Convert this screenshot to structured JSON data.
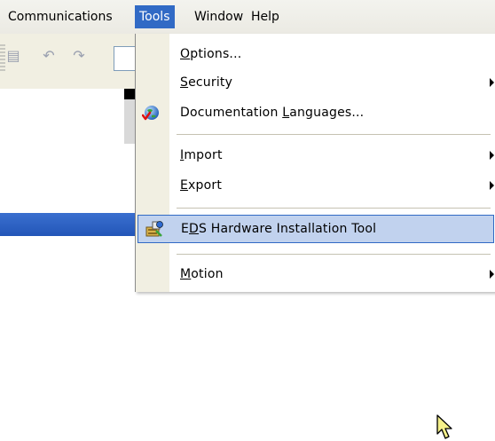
{
  "menubar": {
    "items": [
      {
        "label": "Communications"
      },
      {
        "label": "Tools"
      },
      {
        "label": "Window"
      },
      {
        "label": "Help"
      }
    ]
  },
  "tools_menu": {
    "options": {
      "pre": "",
      "u": "O",
      "post": "ptions..."
    },
    "security": {
      "pre": "",
      "u": "S",
      "post": "ecurity"
    },
    "doc_languages": {
      "pre": "Documentation ",
      "u": "L",
      "post": "anguages..."
    },
    "import": {
      "pre": "",
      "u": "I",
      "post": "mport"
    },
    "export": {
      "pre": "",
      "u": "E",
      "post": "xport"
    },
    "eds_tool": {
      "pre": "E",
      "u": "D",
      "post": "S Hardware Installation Tool"
    },
    "motion": {
      "pre": "",
      "u": "M",
      "post": "otion"
    }
  },
  "colors": {
    "highlight_bg": "#c1d2ee",
    "highlight_border": "#316ac5",
    "active_menu": "#316ac5"
  },
  "icons": {
    "doc_languages": "globe-check-icon",
    "eds_tool": "eds-hardware-icon",
    "cursor": "mouse-pointer-icon"
  }
}
